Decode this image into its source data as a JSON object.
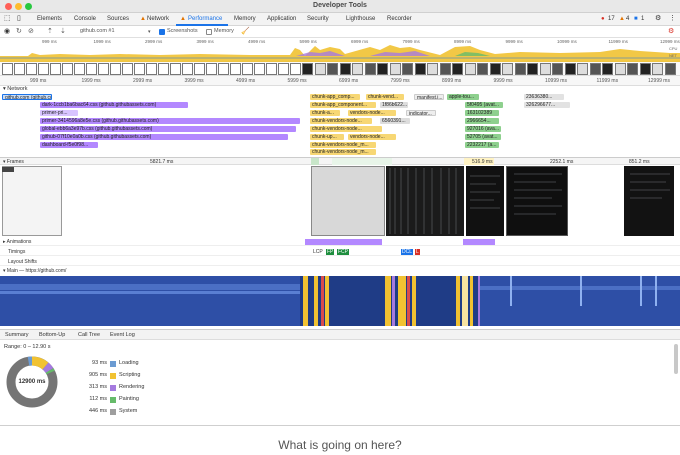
{
  "window": {
    "title": "Developer Tools",
    "traffic_lights": {
      "close": "#ff5f57",
      "minimize": "#febc2e",
      "zoom": "#28c840"
    }
  },
  "tabs": [
    {
      "label": "Elements",
      "icon": "cursor-inspect-icon"
    },
    {
      "label": "Console"
    },
    {
      "label": "Sources"
    },
    {
      "label": "Network",
      "warning": true
    },
    {
      "label": "Performance",
      "warning": true,
      "active": true
    },
    {
      "label": "Memory"
    },
    {
      "label": "Application"
    },
    {
      "label": "Security"
    },
    {
      "label": "Lighthouse"
    },
    {
      "label": "Recorder"
    }
  ],
  "issues": {
    "errors": "17",
    "warnings": "4",
    "info": "1"
  },
  "toolbar": {
    "origin": "github.com #1",
    "screenshots_label": "Screenshots",
    "screenshots_checked": true,
    "memory_label": "Memory",
    "memory_checked": false
  },
  "overview_ticks": [
    "999 ms",
    "1999 ms",
    "2999 ms",
    "3999 ms",
    "4999 ms",
    "5999 ms",
    "6999 ms",
    "7999 ms",
    "8999 ms",
    "9999 ms",
    "10999 ms",
    "11999 ms",
    "12999 ms"
  ],
  "overview_side_labels": [
    "CPU",
    "NET"
  ],
  "ruler_ticks": [
    "999 ms",
    "1999 ms",
    "2999 ms",
    "3999 ms",
    "4999 ms",
    "5999 ms",
    "6999 ms",
    "7999 ms",
    "8999 ms",
    "9999 ms",
    "10999 ms",
    "11999 ms",
    "12999 ms"
  ],
  "network": {
    "label": "Network",
    "requests": [
      "github.com (github.com)",
      "dark-1ccb1ba6bac64.css (github.githubassets.com)",
      "primer-pri...",
      "primer-3414596a8e5e.css (github.githubassets.com)",
      "global-ebb6a3e97b.css (github.githubassets.com)",
      "github-07f10e0a0b.css (github.githubassets.com)",
      "dashboard-f5e0f98..."
    ],
    "chunks": [
      "chunk-app_comp...",
      "chunk-vend...",
      "manifest.j...",
      "apple-tou...",
      "chunk-app_component...",
      "1f86b622...",
      "chunk-a...",
      "vendors-node...",
      "indicator...",
      "chunk-vendors-node...",
      "6560391...",
      "chunk-vendors-node...",
      "chunk-app...",
      "chunk-up...",
      "vendors-node...",
      "chunk-vendors-node_m...",
      "chunk-vendors-node_m..."
    ],
    "right_ids": [
      "5f0495 (avat...",
      "163102389",
      "2966654...",
      "927016 (ava...",
      "52705 (avat...",
      "2232217 (a...",
      "23636380...",
      "326296677..."
    ]
  },
  "frames": {
    "label": "Frames",
    "durations": [
      "5821.7 ms",
      "516.9 ms",
      "2252.1 ms",
      "851.2 ms"
    ]
  },
  "tracks": {
    "animations": "Animations",
    "timings": "Timings",
    "layout_shifts": "Layout Shifts",
    "main": "Main — https://github.com/"
  },
  "timing_markers": [
    {
      "label": "LCP",
      "color": "#1e8e3e"
    },
    {
      "label": "FP",
      "color": "#1e8e3e"
    },
    {
      "label": "FCP",
      "color": "#1e8e3e"
    },
    {
      "label": "DCL",
      "color": "#1a73e8"
    },
    {
      "label": "L",
      "color": "#d93025"
    }
  ],
  "bottom_tabs": [
    "Summary",
    "Bottom-Up",
    "Call Tree",
    "Event Log"
  ],
  "summary": {
    "range": "Range: 0 – 12.90 s",
    "total": "12900 ms",
    "items": [
      {
        "value": "93 ms",
        "name": "Loading",
        "color": "#6b9bd2"
      },
      {
        "value": "905 ms",
        "name": "Scripting",
        "color": "#f1c232"
      },
      {
        "value": "313 ms",
        "name": "Rendering",
        "color": "#a57adf"
      },
      {
        "value": "112 ms",
        "name": "Painting",
        "color": "#66bb6a"
      },
      {
        "value": "446 ms",
        "name": "System",
        "color": "#9e9e9e"
      }
    ]
  },
  "caption": "What is going on here?"
}
